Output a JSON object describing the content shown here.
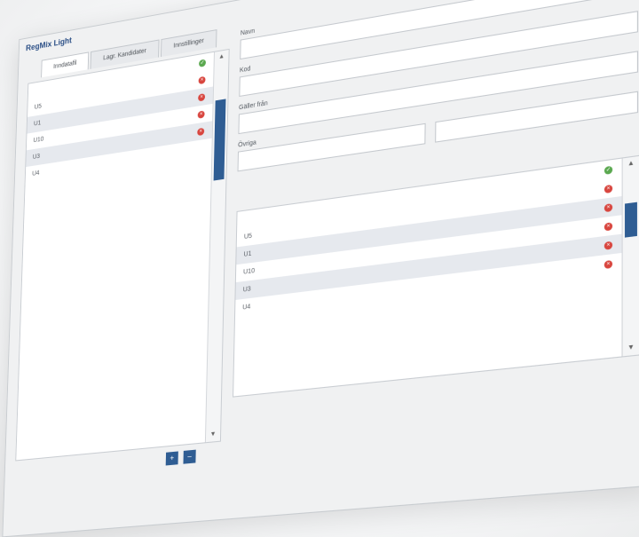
{
  "window": {
    "title": "RegMix Light",
    "controls": [
      "+",
      "–",
      "×"
    ]
  },
  "tabs": [
    {
      "label": "Inndatafil",
      "active": true
    },
    {
      "label": "Lagr. Kandidater",
      "active": false
    },
    {
      "label": "Innstillinger",
      "active": false
    }
  ],
  "left_list": {
    "header_icon": "check-icon",
    "items": [
      {
        "label": "U5",
        "status": "delete"
      },
      {
        "label": "U1",
        "status": "delete"
      },
      {
        "label": "U10",
        "status": "delete"
      },
      {
        "label": "U3",
        "status": "delete"
      },
      {
        "label": "U4",
        "status": ""
      }
    ]
  },
  "form": {
    "name_label": "Navn",
    "code_label": "Kod",
    "valid_from_label": "Gäller från",
    "other_label": "Övriga"
  },
  "right_list": {
    "header_icon": "check-icon",
    "items": [
      {
        "label": "U5",
        "status": "delete"
      },
      {
        "label": "U1",
        "status": "delete"
      },
      {
        "label": "U10",
        "status": "delete"
      },
      {
        "label": "U3",
        "status": "delete"
      },
      {
        "label": "U4",
        "status": "delete"
      }
    ]
  },
  "buttons": {
    "add": "+",
    "remove": "–"
  },
  "colors": {
    "accent": "#2f5d93",
    "ok": "#5aa84f",
    "delete": "#d8453e"
  }
}
